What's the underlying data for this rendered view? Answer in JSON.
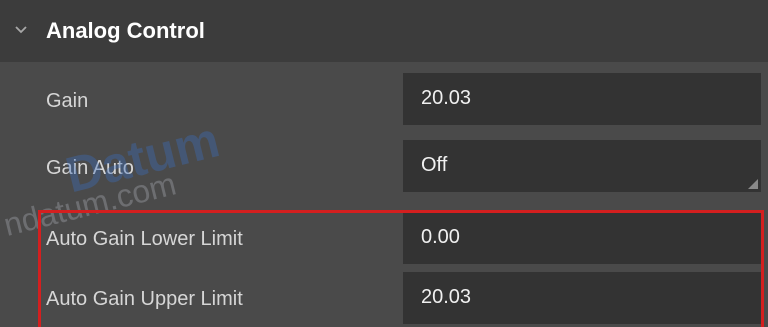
{
  "section": {
    "title": "Analog Control",
    "expanded": true
  },
  "rows": [
    {
      "label": "Gain",
      "value": "20.03",
      "control": "number"
    },
    {
      "label": "Gain Auto",
      "value": "Off",
      "control": "dropdown"
    },
    {
      "label": "Auto Gain Lower Limit",
      "value": "0.00",
      "control": "number"
    },
    {
      "label": "Auto Gain Upper Limit",
      "value": "20.03",
      "control": "number"
    }
  ],
  "watermark": {
    "brand": "Datum",
    "url": "ndatum.com"
  },
  "colors": {
    "background": "#4a4a4a",
    "header_background": "#3c3c3c",
    "field_background": "#333333",
    "highlight_border": "#d41f1f"
  }
}
